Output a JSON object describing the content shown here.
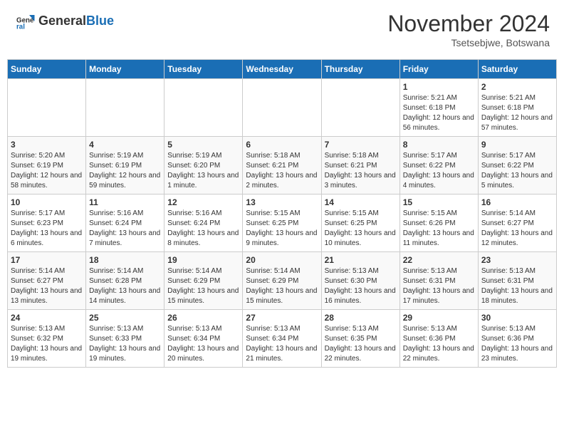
{
  "header": {
    "logo_line1": "General",
    "logo_line2": "Blue",
    "month_title": "November 2024",
    "subtitle": "Tsetsebjwe, Botswana"
  },
  "days_of_week": [
    "Sunday",
    "Monday",
    "Tuesday",
    "Wednesday",
    "Thursday",
    "Friday",
    "Saturday"
  ],
  "weeks": [
    [
      {
        "day": "",
        "info": ""
      },
      {
        "day": "",
        "info": ""
      },
      {
        "day": "",
        "info": ""
      },
      {
        "day": "",
        "info": ""
      },
      {
        "day": "",
        "info": ""
      },
      {
        "day": "1",
        "info": "Sunrise: 5:21 AM\nSunset: 6:18 PM\nDaylight: 12 hours and 56 minutes."
      },
      {
        "day": "2",
        "info": "Sunrise: 5:21 AM\nSunset: 6:18 PM\nDaylight: 12 hours and 57 minutes."
      }
    ],
    [
      {
        "day": "3",
        "info": "Sunrise: 5:20 AM\nSunset: 6:19 PM\nDaylight: 12 hours and 58 minutes."
      },
      {
        "day": "4",
        "info": "Sunrise: 5:19 AM\nSunset: 6:19 PM\nDaylight: 12 hours and 59 minutes."
      },
      {
        "day": "5",
        "info": "Sunrise: 5:19 AM\nSunset: 6:20 PM\nDaylight: 13 hours and 1 minute."
      },
      {
        "day": "6",
        "info": "Sunrise: 5:18 AM\nSunset: 6:21 PM\nDaylight: 13 hours and 2 minutes."
      },
      {
        "day": "7",
        "info": "Sunrise: 5:18 AM\nSunset: 6:21 PM\nDaylight: 13 hours and 3 minutes."
      },
      {
        "day": "8",
        "info": "Sunrise: 5:17 AM\nSunset: 6:22 PM\nDaylight: 13 hours and 4 minutes."
      },
      {
        "day": "9",
        "info": "Sunrise: 5:17 AM\nSunset: 6:22 PM\nDaylight: 13 hours and 5 minutes."
      }
    ],
    [
      {
        "day": "10",
        "info": "Sunrise: 5:17 AM\nSunset: 6:23 PM\nDaylight: 13 hours and 6 minutes."
      },
      {
        "day": "11",
        "info": "Sunrise: 5:16 AM\nSunset: 6:24 PM\nDaylight: 13 hours and 7 minutes."
      },
      {
        "day": "12",
        "info": "Sunrise: 5:16 AM\nSunset: 6:24 PM\nDaylight: 13 hours and 8 minutes."
      },
      {
        "day": "13",
        "info": "Sunrise: 5:15 AM\nSunset: 6:25 PM\nDaylight: 13 hours and 9 minutes."
      },
      {
        "day": "14",
        "info": "Sunrise: 5:15 AM\nSunset: 6:25 PM\nDaylight: 13 hours and 10 minutes."
      },
      {
        "day": "15",
        "info": "Sunrise: 5:15 AM\nSunset: 6:26 PM\nDaylight: 13 hours and 11 minutes."
      },
      {
        "day": "16",
        "info": "Sunrise: 5:14 AM\nSunset: 6:27 PM\nDaylight: 13 hours and 12 minutes."
      }
    ],
    [
      {
        "day": "17",
        "info": "Sunrise: 5:14 AM\nSunset: 6:27 PM\nDaylight: 13 hours and 13 minutes."
      },
      {
        "day": "18",
        "info": "Sunrise: 5:14 AM\nSunset: 6:28 PM\nDaylight: 13 hours and 14 minutes."
      },
      {
        "day": "19",
        "info": "Sunrise: 5:14 AM\nSunset: 6:29 PM\nDaylight: 13 hours and 15 minutes."
      },
      {
        "day": "20",
        "info": "Sunrise: 5:14 AM\nSunset: 6:29 PM\nDaylight: 13 hours and 15 minutes."
      },
      {
        "day": "21",
        "info": "Sunrise: 5:13 AM\nSunset: 6:30 PM\nDaylight: 13 hours and 16 minutes."
      },
      {
        "day": "22",
        "info": "Sunrise: 5:13 AM\nSunset: 6:31 PM\nDaylight: 13 hours and 17 minutes."
      },
      {
        "day": "23",
        "info": "Sunrise: 5:13 AM\nSunset: 6:31 PM\nDaylight: 13 hours and 18 minutes."
      }
    ],
    [
      {
        "day": "24",
        "info": "Sunrise: 5:13 AM\nSunset: 6:32 PM\nDaylight: 13 hours and 19 minutes."
      },
      {
        "day": "25",
        "info": "Sunrise: 5:13 AM\nSunset: 6:33 PM\nDaylight: 13 hours and 19 minutes."
      },
      {
        "day": "26",
        "info": "Sunrise: 5:13 AM\nSunset: 6:34 PM\nDaylight: 13 hours and 20 minutes."
      },
      {
        "day": "27",
        "info": "Sunrise: 5:13 AM\nSunset: 6:34 PM\nDaylight: 13 hours and 21 minutes."
      },
      {
        "day": "28",
        "info": "Sunrise: 5:13 AM\nSunset: 6:35 PM\nDaylight: 13 hours and 22 minutes."
      },
      {
        "day": "29",
        "info": "Sunrise: 5:13 AM\nSunset: 6:36 PM\nDaylight: 13 hours and 22 minutes."
      },
      {
        "day": "30",
        "info": "Sunrise: 5:13 AM\nSunset: 6:36 PM\nDaylight: 13 hours and 23 minutes."
      }
    ]
  ]
}
